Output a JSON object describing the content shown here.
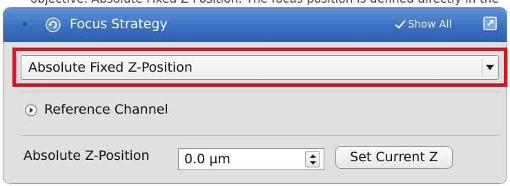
{
  "top_text": "objective. Absolute Fixed Z-Position: The focus position is defined directly in the Z position field.",
  "panel": {
    "title": "Focus Strategy",
    "show_all_label": "Show All"
  },
  "focus_mode": {
    "selected": "Absolute Fixed Z-Position"
  },
  "reference_channel": {
    "label": "Reference Channel"
  },
  "absolute_z": {
    "label": "Absolute Z-Position",
    "value": "0.0 µm"
  },
  "set_current_z": {
    "label": "Set Current Z"
  },
  "colors": {
    "title_bar": "#3b71c2",
    "highlight": "#e0141e",
    "panel_bg": "#dfdfdf"
  },
  "icons": {
    "title_refresh": "refresh-icon",
    "show_all_check": "check-icon",
    "popout": "popout-icon",
    "dropdown_arrow": "chevron-down-icon",
    "expand": "expand-arrow-icon",
    "stepper": "stepper-icon"
  }
}
